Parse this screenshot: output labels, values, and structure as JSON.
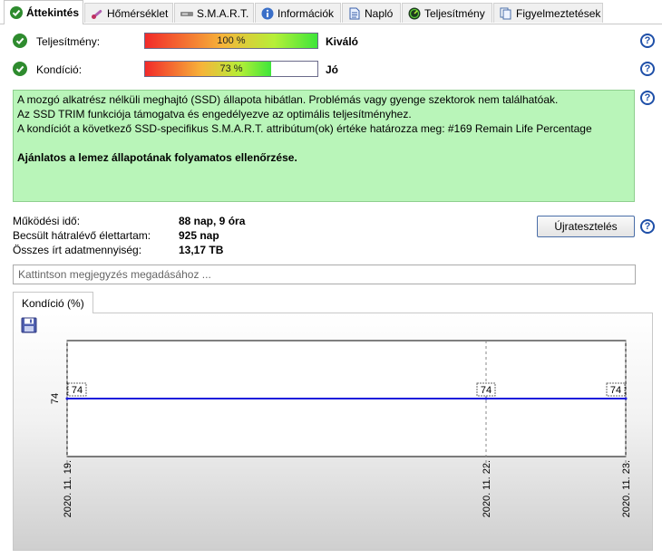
{
  "tabs": [
    {
      "label": "Áttekintés",
      "icon": "check-icon",
      "active": true
    },
    {
      "label": "Hőmérséklet",
      "icon": "thermometer-icon"
    },
    {
      "label": "S.M.A.R.T.",
      "icon": "drive-icon"
    },
    {
      "label": "Információk",
      "icon": "info-icon"
    },
    {
      "label": "Napló",
      "icon": "log-icon"
    },
    {
      "label": "Teljesítmény",
      "icon": "performance-icon"
    },
    {
      "label": "Figyelmeztetések",
      "icon": "warnings-icon"
    }
  ],
  "performance": {
    "label": "Teljesítmény:",
    "percent_text": "100 %",
    "value": 100,
    "rating": "Kiváló"
  },
  "condition": {
    "label": "Kondíció:",
    "percent_text": "73 %",
    "value": 73,
    "rating": "Jó"
  },
  "info": {
    "line1": "A mozgó alkatrész nélküli meghajtó (SSD) állapota hibátlan. Problémás vagy gyenge szektorok nem találhatóak.",
    "line2": "Az SSD TRIM funkciója támogatva és engedélyezve az optimális teljesítményhez.",
    "line3": "A kondíciót a következő SSD-specifikus S.M.A.R.T. attribútum(ok) értéke határozza meg:  #169 Remain Life Percentage",
    "recommendation": "Ajánlatos a lemez állapotának folyamatos ellenőrzése."
  },
  "stats": {
    "uptime_label": "Működési idő:",
    "uptime_value": "88 nap, 9 óra",
    "lifetime_label": "Becsült hátralévő élettartam:",
    "lifetime_value": "925 nap",
    "written_label": "Összes írt adatmennyiség:",
    "written_value": "13,17 TB"
  },
  "retest_label": "Újratesztelés",
  "note_placeholder": "Kattintson megjegyzés megadásához ...",
  "chart_tab_label": "Kondíció  (%)",
  "colors": {
    "info_bg": "#b9f5b9",
    "series_line": "#1a1adc",
    "ok_green": "#2e8b2e",
    "help_blue": "#1e4fa8"
  },
  "chart_data": {
    "type": "line",
    "x": [
      "2020. 11. 19.",
      "2020. 11. 22.",
      "2020. 11. 23."
    ],
    "x_days": [
      0,
      3,
      4
    ],
    "series": [
      {
        "values": [
          74,
          74,
          74
        ]
      }
    ],
    "y_ticks": [
      74
    ],
    "data_labels": [
      "74",
      "74",
      "74"
    ],
    "grid": true
  }
}
